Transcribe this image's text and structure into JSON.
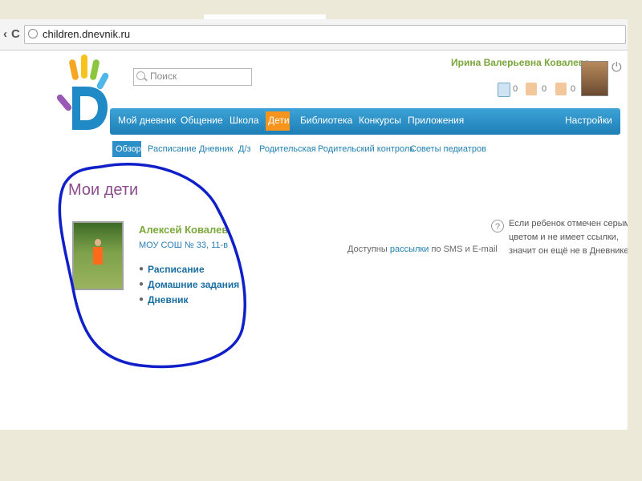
{
  "browser": {
    "back_glyph": "‹",
    "reload_glyph": "C",
    "url": "children.dnevnik.ru"
  },
  "header": {
    "search_placeholder": "Поиск",
    "user_name": "Ирина Валерьевна Ковалева",
    "counters": [
      "0",
      "0",
      "0"
    ]
  },
  "main_nav": {
    "items": [
      "Мой дневник",
      "Общение",
      "Школа",
      "Дети",
      "Библиотека",
      "Конкурсы",
      "Приложения"
    ],
    "active": "Дети",
    "settings": "Настройки"
  },
  "sub_nav": {
    "items": [
      "Обзор",
      "Расписание",
      "Дневник",
      "Д/з",
      "Родительская",
      "Родительский контроль",
      "Советы педиатров"
    ],
    "active": "Обзор"
  },
  "page": {
    "title": "Мои дети",
    "child": {
      "name": "Алексей Ковалев",
      "school": "МОУ СОШ № 33, 11-в",
      "links": [
        "Расписание",
        "Домашние задания",
        "Дневник"
      ]
    },
    "sms_note": {
      "before": "Доступны",
      "link": "рассылки",
      "after": "по SMS и E-mail"
    },
    "help_lines": [
      "Если ребенок отмечен серым",
      "цветом и не имеет ссылки,",
      "значит он ещё не в Дневнике."
    ]
  },
  "colors": {
    "nav_blue": "#1c7eb6",
    "active_orange": "#f7941d",
    "title_purple": "#8c4d8e",
    "name_green": "#7aa83a",
    "annotation_blue": "#1020c8"
  },
  "icons": {
    "help": "?",
    "power": "⏻"
  }
}
